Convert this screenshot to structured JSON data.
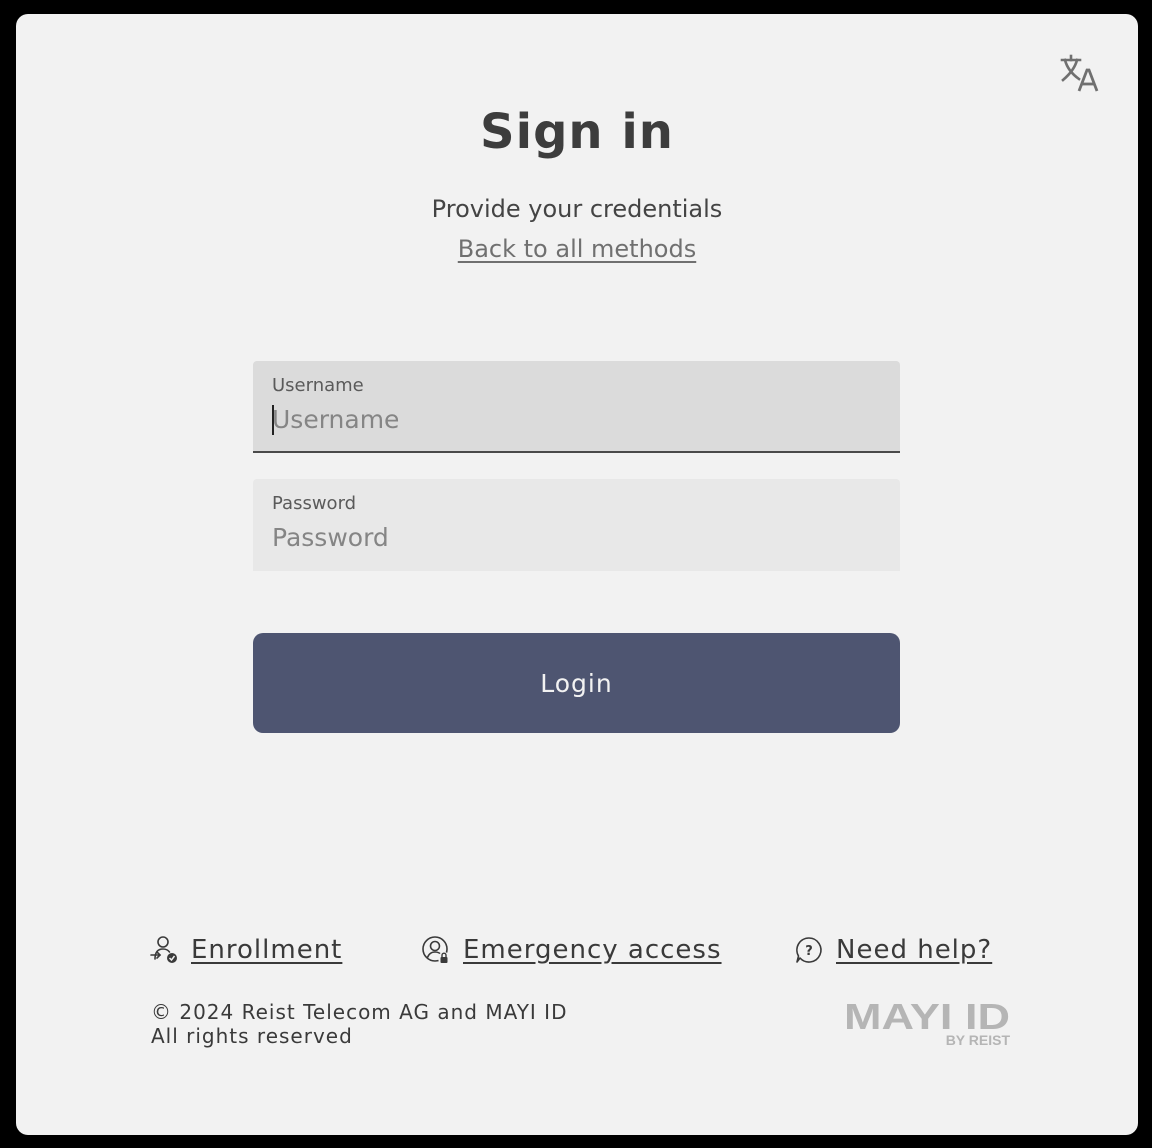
{
  "colors": {
    "background": "#f2f2f2",
    "frame": "#000000",
    "primary_button": "#4e5571",
    "username_field": "#dbdbdb",
    "password_field": "#e8e8e8"
  },
  "header": {
    "language_icon": "translate-icon",
    "title": "Sign in",
    "subtitle": "Provide your credentials",
    "back_link": "Back to all methods"
  },
  "form": {
    "username": {
      "label": "Username",
      "placeholder": "Username",
      "value": ""
    },
    "password": {
      "label": "Password",
      "placeholder": "Password",
      "value": ""
    },
    "login_label": "Login"
  },
  "footer": {
    "links": [
      {
        "label": "Enrollment",
        "icon": "user-check-icon"
      },
      {
        "label": "Emergency access",
        "icon": "user-lock-icon"
      },
      {
        "label": "Need help?",
        "icon": "help-chat-icon"
      }
    ],
    "copyright_line1": "© 2024 Reist Telecom AG and MAYI ID",
    "copyright_line2": "All rights reserved",
    "logo": {
      "brand": "MAYI ID",
      "tagline": "BY REIST"
    }
  }
}
